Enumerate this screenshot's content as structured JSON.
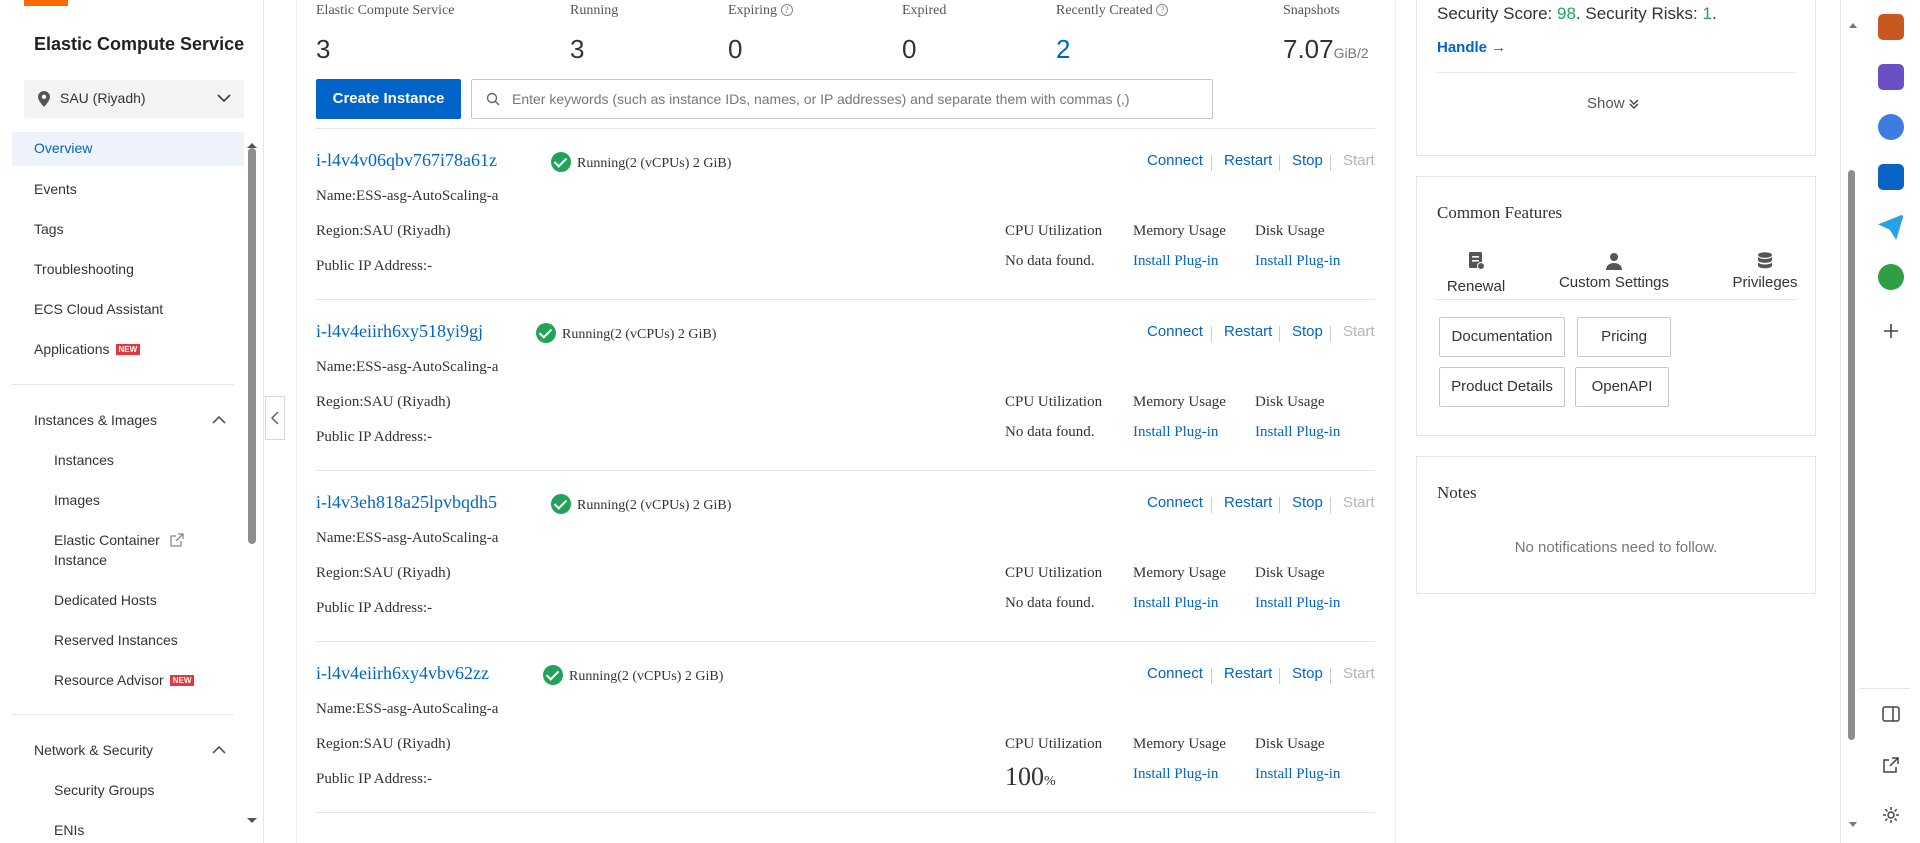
{
  "sidebar": {
    "title": "Elastic Compute Service",
    "region": "SAU (Riyadh)",
    "new_badge": "NEW",
    "items": [
      {
        "label": "Overview"
      },
      {
        "label": "Events"
      },
      {
        "label": "Tags"
      },
      {
        "label": "Troubleshooting"
      },
      {
        "label": "ECS Cloud Assistant"
      },
      {
        "label": "Applications"
      }
    ],
    "groups": [
      {
        "label": "Instances & Images",
        "items": [
          "Instances",
          "Images",
          "Elastic Container",
          "Instance",
          "Dedicated Hosts",
          "Reserved Instances",
          "Resource Advisor"
        ]
      },
      {
        "label": "Network & Security",
        "items": [
          "Security Groups",
          "ENIs"
        ]
      }
    ]
  },
  "stats": [
    {
      "label": "Elastic Compute Service",
      "value": "3"
    },
    {
      "label": "Running",
      "value": "3"
    },
    {
      "label": "Expiring",
      "value": "0"
    },
    {
      "label": "Expired",
      "value": "0"
    },
    {
      "label": "Recently Created",
      "value": "2"
    },
    {
      "label": "Snapshots",
      "value": "7.07",
      "unit": "GiB/2"
    }
  ],
  "toolbar": {
    "create_label": "Create Instance",
    "search_placeholder": "Enter keywords (such as instance IDs, names, or IP addresses) and separate them with commas (,)"
  },
  "labels": {
    "connect": "Connect",
    "restart": "Restart",
    "stop": "Stop",
    "start": "Start",
    "cpu": "CPU Utilization",
    "memory": "Memory Usage",
    "disk": "Disk Usage",
    "install": "Install Plug-in",
    "nodata": "No data found."
  },
  "instances": [
    {
      "id": "i-l4v4v06qbv767i78a61z",
      "status": "Running(2 (vCPUs) 2 GiB)",
      "name": "Name:ESS-asg-AutoScaling-a",
      "region": "Region:SAU (Riyadh)",
      "ip": "Public IP Address:-",
      "cpu": "No data found."
    },
    {
      "id": "i-l4v4eiirh6xy518yi9gj",
      "status": "Running(2 (vCPUs) 2 GiB)",
      "name": "Name:ESS-asg-AutoScaling-a",
      "region": "Region:SAU (Riyadh)",
      "ip": "Public IP Address:-",
      "cpu": "No data found."
    },
    {
      "id": "i-l4v3eh818a25lpvbqdh5",
      "status": "Running(2 (vCPUs) 2 GiB)",
      "name": "Name:ESS-asg-AutoScaling-a",
      "region": "Region:SAU (Riyadh)",
      "ip": "Public IP Address:-",
      "cpu": "No data found."
    },
    {
      "id": "i-l4v4eiirh6xy4vbv62zz",
      "status": "Running(2 (vCPUs) 2 GiB)",
      "name": "Name:ESS-asg-AutoScaling-a",
      "region": "Region:SAU (Riyadh)",
      "ip": "Public IP Address:-",
      "cpu": "100",
      "cpu_unit": "%"
    }
  ],
  "security": {
    "score_label": "Security Score:",
    "score": "98",
    "risks_label": "Security Risks:",
    "risks": "1",
    "handle": "Handle →",
    "show": "Show"
  },
  "features": {
    "title": "Common Features",
    "shortcuts": [
      "Renewal",
      "Custom Settings",
      "Privileges"
    ],
    "buttons": [
      "Documentation",
      "Pricing",
      "Product Details",
      "OpenAPI"
    ]
  },
  "notes": {
    "title": "Notes",
    "empty": "No notifications need to follow."
  },
  "colors": {
    "accent": "#0064c8",
    "success": "#23a35a",
    "brand": "#ff6a00",
    "badge": "#e4393c"
  }
}
